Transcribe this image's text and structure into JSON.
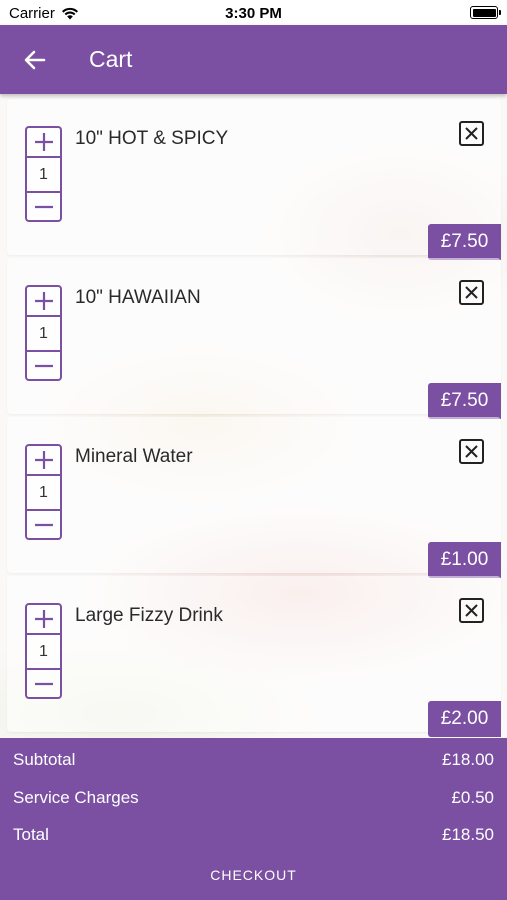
{
  "status_bar": {
    "carrier": "Carrier",
    "time": "3:30 PM"
  },
  "app_bar": {
    "title": "Cart"
  },
  "items": [
    {
      "name": "10\" HOT & SPICY",
      "quantity": "1",
      "price": "£7.50"
    },
    {
      "name": "10\" HAWAIIAN",
      "quantity": "1",
      "price": "£7.50"
    },
    {
      "name": "Mineral Water",
      "quantity": "1",
      "price": "£1.00"
    },
    {
      "name": "Large Fizzy Drink",
      "quantity": "1",
      "price": "£2.00"
    }
  ],
  "summary": {
    "subtotal_label": "Subtotal",
    "subtotal_value": "£18.00",
    "service_label": "Service Charges",
    "service_value": "£0.50",
    "total_label": "Total",
    "total_value": "£18.50",
    "checkout_label": "CHECKOUT"
  },
  "colors": {
    "accent": "#7b4fa2"
  }
}
